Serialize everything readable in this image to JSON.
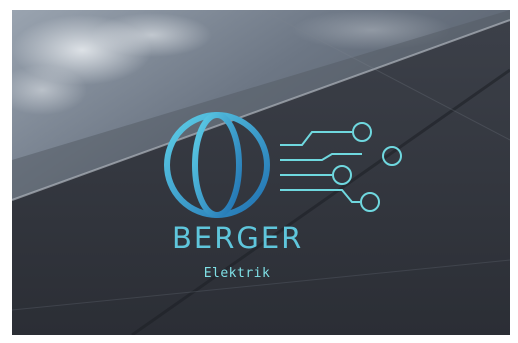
{
  "brand": {
    "name": "BERGER",
    "subtitle": "Elektrik"
  },
  "colors": {
    "globe_light": "#5fd0e8",
    "globe_dark": "#1f6fb0",
    "circuit": "#6fd8df",
    "text": "#5fc6dc"
  },
  "icons": {
    "logo": "globe-circuit-icon",
    "background": "solar-panel-sky-photo"
  }
}
